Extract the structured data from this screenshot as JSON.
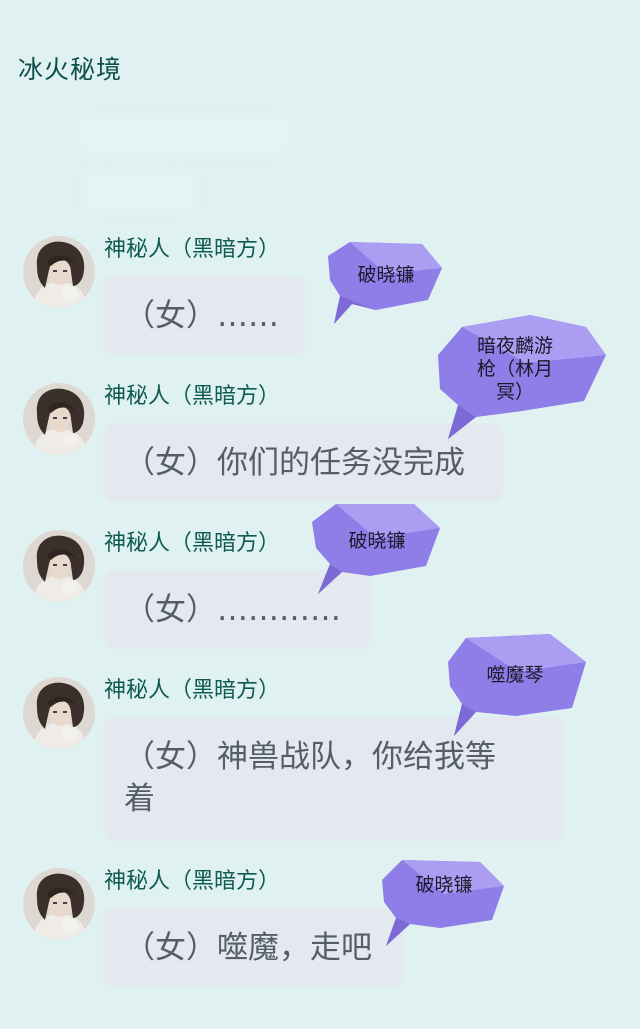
{
  "header": {
    "title": "冰火秘境"
  },
  "messages": [
    {
      "sender": "神秘人（黑暗方）",
      "text": "（女）……",
      "tag": "破晓镰"
    },
    {
      "sender": "神秘人（黑暗方）",
      "text": "（女）你们的任务没完成",
      "tag": "暗夜麟游枪（林月冥）"
    },
    {
      "sender": "神秘人（黑暗方）",
      "text": "（女）…………",
      "tag": "破晓镰"
    },
    {
      "sender": "神秘人（黑暗方）",
      "text": "（女）神兽战队，你给我等着",
      "tag": "噬魔琴"
    },
    {
      "sender": "神秘人（黑暗方）",
      "text": "（女）噬魔，走吧",
      "tag": "破晓镰"
    }
  ],
  "colors": {
    "background": "#dff1f0",
    "title": "#0d4f4a",
    "sender_name": "#0f5a52",
    "bubble": "#e4e9ef",
    "bubble_text": "#555d6b",
    "tag_fill": "#8f7ee8"
  },
  "icons": {
    "avatar": "dark-haired-character-avatar"
  }
}
